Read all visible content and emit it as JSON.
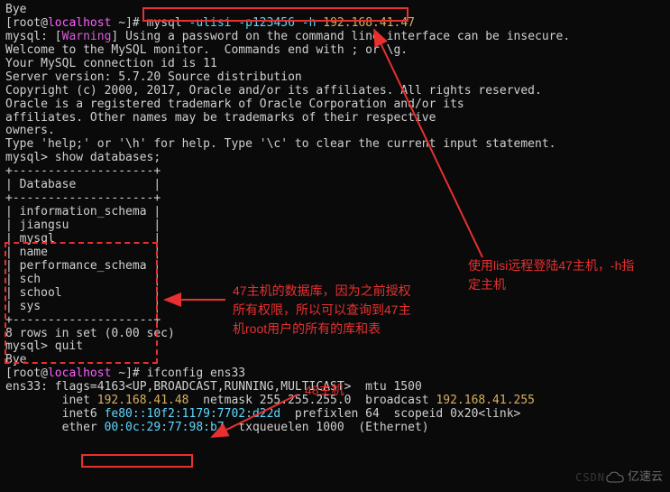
{
  "terminal": {
    "bye0": "Bye",
    "prompt1": {
      "pre": "[root@",
      "host": "localhost",
      "post": " ~]# "
    },
    "cmd1": {
      "mysql": "mysql ",
      "user": "-ulisi ",
      "pass": "-p123456 ",
      "hflag": "-h ",
      "ip": "192.168.41.47"
    },
    "warn_line": {
      "pre": "mysql: [",
      "warn": "Warning",
      "post": "] Using a password on the command line interface can be insecure."
    },
    "welcome1": "Welcome to the MySQL monitor.  Commands end with ; or \\g.",
    "connid": "Your MySQL connection id is 11",
    "server": "Server version: 5.7.20 Source distribution",
    "blank1": "",
    "copyright": "Copyright (c) 2000, 2017, Oracle and/or its affiliates. All rights reserved.",
    "blank2": "",
    "trademark1": "Oracle is a registered trademark of Oracle Corporation and/or its",
    "trademark2": "affiliates. Other names may be trademarks of their respective",
    "trademark3": "owners.",
    "blank3": "",
    "help": "Type 'help;' or '\\h' for help. Type '\\c' to clear the current input statement.",
    "blank4": "",
    "showdb": "mysql> show databases;",
    "tblborder1": "+--------------------+",
    "tblheader": "| Database           |",
    "tblborder2": "+--------------------+",
    "tblrows": [
      "| information_schema |",
      "| jiangsu            |",
      "| mysql              |",
      "| name               |",
      "| performance_schema |",
      "| sch                |",
      "| school             |",
      "| sys                |"
    ],
    "tblborder3": "+--------------------+",
    "rowcount": "8 rows in set (0.00 sec)",
    "blank5": "",
    "quit": "mysql> quit",
    "bye1": "Bye",
    "prompt2": {
      "pre": "[root@",
      "host": "localhost",
      "post": " ~]# "
    },
    "ifconfig": "ifconfig ens33",
    "ens_line": "ens33: flags=4163<UP,BROADCAST,RUNNING,MULTICAST>  mtu 1500",
    "inet_line": {
      "pre": "        inet ",
      "ip": "192.168.41.48",
      "mid": "  netmask 255.255.255.0  broadcast ",
      "bcast": "192.168.41.255"
    },
    "inet6_line": {
      "pre": "        inet6 ",
      "addr": "fe80::10f2:1179:7702:d22d",
      "post": "  prefixlen 64  scopeid 0x20<link>"
    },
    "ether_line": {
      "pre": "        ether ",
      "mac": "00:0c:29:77:98:b7",
      "post": "  txqueuelen 1000  (Ethernet)"
    }
  },
  "annotations": {
    "right_top": "使用lisi远程登陆47主机，-h指\n定主机",
    "middle": "47主机的数据库，因为之前授权\n所有权限，所以可以查询到47主\n机root用户的所有的库和表",
    "host48": "48主机"
  },
  "watermark": {
    "yisu": "亿速云",
    "csdn": "CSDN"
  }
}
